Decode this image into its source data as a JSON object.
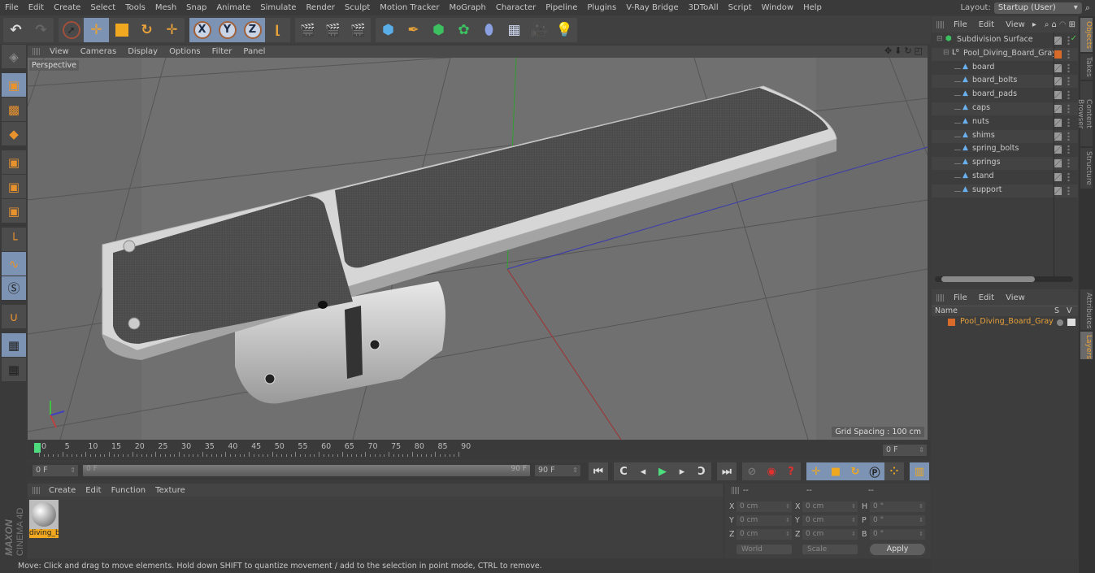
{
  "menubar": {
    "items": [
      "File",
      "Edit",
      "Create",
      "Select",
      "Tools",
      "Mesh",
      "Snap",
      "Animate",
      "Simulate",
      "Render",
      "Sculpt",
      "Motion Tracker",
      "MoGraph",
      "Character",
      "Pipeline",
      "Plugins",
      "V-Ray Bridge",
      "3DToAll",
      "Script",
      "Window",
      "Help"
    ],
    "layout_label": "Layout:",
    "layout_value": "Startup (User)"
  },
  "toolbar": {
    "groups": [
      [
        "undo-icon",
        "redo-icon"
      ],
      [
        "live-selection-icon",
        "move-icon",
        "scale-icon",
        "rotate-icon",
        "recent-tool-icon"
      ],
      [
        "x-axis-icon",
        "y-axis-icon",
        "z-axis-icon",
        "coordinate-system-icon"
      ],
      [
        "render-view-icon",
        "render-to-picture-viewer-icon",
        "edit-render-settings-icon"
      ],
      [
        "cube-icon",
        "pen-icon",
        "subdivision-surface-icon",
        "cloner-icon",
        "deformer-icon",
        "floor-icon",
        "camera-icon",
        "light-icon"
      ]
    ],
    "axis_labels": [
      "X",
      "Y",
      "Z"
    ]
  },
  "left_tools": [
    "make-editable-icon",
    "model-mode-icon",
    "texture-mode-icon",
    "workplane-mode-icon",
    "points-mode-icon",
    "edges-mode-icon",
    "polygons-mode-icon",
    "axis-mode-icon",
    "tweak-mode-icon",
    "solo-icon",
    "snapping-icon",
    "workplane-lock-icon",
    "workplane-align-icon"
  ],
  "viewport": {
    "menu": [
      "View",
      "Cameras",
      "Display",
      "Options",
      "Filter",
      "Panel"
    ],
    "camera_label": "Perspective",
    "grid_spacing": "Grid Spacing : 100 cm",
    "nav_icons": [
      "pan-icon",
      "dolly-icon",
      "orbit-icon",
      "maximize-icon"
    ]
  },
  "timeline": {
    "ticks": [
      "0",
      "5",
      "10",
      "15",
      "20",
      "25",
      "30",
      "35",
      "40",
      "45",
      "50",
      "55",
      "60",
      "65",
      "70",
      "75",
      "80",
      "85",
      "90"
    ],
    "current_frame": "0 F",
    "start_field": "0 F",
    "range_start": "0 F",
    "range_end": "90 F",
    "end_field": "90 F",
    "playback_icons": [
      "go-to-start-icon",
      "previous-key-icon",
      "previous-frame-icon",
      "play-icon",
      "next-frame-icon",
      "next-key-icon",
      "go-to-end-icon"
    ],
    "record_icons": [
      "motion-record-icon",
      "record-active-icon",
      "autokey-icon"
    ],
    "key_icons": [
      "position-key-icon",
      "scale-key-icon",
      "rotation-key-icon",
      "parameter-key-icon",
      "pla-key-icon"
    ],
    "timeline_icon": "timeline-window-icon"
  },
  "materials": {
    "menu": [
      "Create",
      "Edit",
      "Function",
      "Texture"
    ],
    "items": [
      {
        "name": "diving_b"
      }
    ]
  },
  "coordinates": {
    "headers": [
      "--",
      "--",
      "--"
    ],
    "rows": [
      {
        "l1": "X",
        "v1": "0 cm",
        "l2": "X",
        "v2": "0 cm",
        "l3": "H",
        "v3": "0 °"
      },
      {
        "l1": "Y",
        "v1": "0 cm",
        "l2": "Y",
        "v2": "0 cm",
        "l3": "P",
        "v3": "0 °"
      },
      {
        "l1": "Z",
        "v1": "0 cm",
        "l2": "Z",
        "v2": "0 cm",
        "l3": "B",
        "v3": "0 °"
      }
    ],
    "mode_dropdown": "World",
    "type_dropdown": "Scale",
    "apply_label": "Apply"
  },
  "status": {
    "text": "Move: Click and drag to move elements. Hold down SHIFT to quantize movement / add to the selection in point mode, CTRL to remove."
  },
  "brand": {
    "line1": "MAXON",
    "line2": "CINEMA 4D"
  },
  "objects_panel": {
    "menu": [
      "File",
      "Edit",
      "View"
    ],
    "tree": [
      {
        "name": "Subdivision Surface",
        "level": 0,
        "icon": "subdivision-surface-icon"
      },
      {
        "name": "Pool_Diving_Board_Gray",
        "level": 1,
        "icon": "null-object-icon",
        "color": "#d86a2a"
      },
      {
        "name": "board",
        "level": 2,
        "icon": "polygon-object-icon"
      },
      {
        "name": "board_bolts",
        "level": 2,
        "icon": "polygon-object-icon"
      },
      {
        "name": "board_pads",
        "level": 2,
        "icon": "polygon-object-icon"
      },
      {
        "name": "caps",
        "level": 2,
        "icon": "polygon-object-icon"
      },
      {
        "name": "nuts",
        "level": 2,
        "icon": "polygon-object-icon"
      },
      {
        "name": "shims",
        "level": 2,
        "icon": "polygon-object-icon"
      },
      {
        "name": "spring_bolts",
        "level": 2,
        "icon": "polygon-object-icon"
      },
      {
        "name": "springs",
        "level": 2,
        "icon": "polygon-object-icon"
      },
      {
        "name": "stand",
        "level": 2,
        "icon": "polygon-object-icon"
      },
      {
        "name": "support",
        "level": 2,
        "icon": "polygon-object-icon"
      }
    ]
  },
  "layers_panel": {
    "menu": [
      "File",
      "Edit",
      "View"
    ],
    "columns": [
      "Name",
      "S",
      "V"
    ],
    "layers": [
      {
        "name": "Pool_Diving_Board_Gray",
        "color": "#d86a2a"
      }
    ]
  },
  "right_tabs": {
    "top": [
      {
        "label": "Objects",
        "active": true
      },
      {
        "label": "Takes",
        "active": false
      },
      {
        "label": "Content Browser",
        "active": false
      },
      {
        "label": "Structure",
        "active": false
      }
    ],
    "bottom": [
      {
        "label": "Attributes",
        "active": false
      },
      {
        "label": "Layers",
        "active": true
      }
    ]
  },
  "colors": {
    "accent": "#e8a23a",
    "active_button": "#7c93b3",
    "layer_orange": "#d86a2a",
    "green_check": "#4fc04f"
  }
}
